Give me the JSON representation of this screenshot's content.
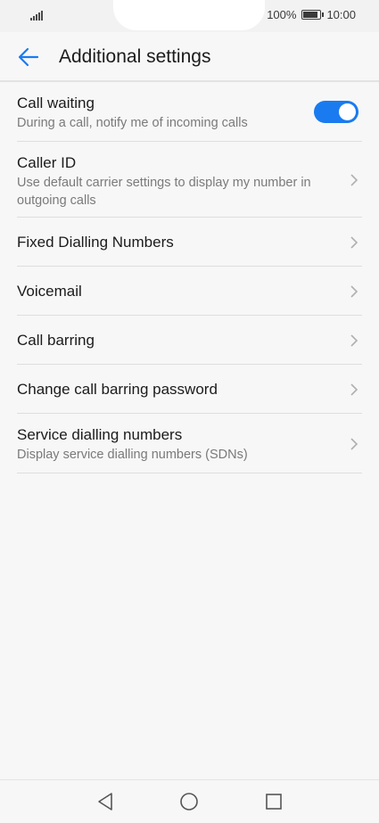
{
  "status_bar": {
    "battery_percent": "100%",
    "battery_level": 1.0,
    "time": "10:00"
  },
  "header": {
    "title": "Additional settings",
    "back_icon": "arrow-left-icon"
  },
  "settings": [
    {
      "label": "Call waiting",
      "sublabel": "During a call, notify me of incoming calls",
      "control": "toggle",
      "toggle_on": true
    },
    {
      "label": "Caller ID",
      "sublabel": "Use default carrier settings to display my number in outgoing calls",
      "control": "chevron"
    },
    {
      "label": "Fixed Dialling Numbers",
      "sublabel": "",
      "control": "chevron"
    },
    {
      "label": "Voicemail",
      "sublabel": "",
      "control": "chevron"
    },
    {
      "label": "Call barring",
      "sublabel": "",
      "control": "chevron"
    },
    {
      "label": "Change call barring password",
      "sublabel": "",
      "control": "chevron"
    },
    {
      "label": "Service dialling numbers",
      "sublabel": "Display service dialling numbers (SDNs)",
      "control": "chevron"
    }
  ],
  "colors": {
    "accent": "#1a7bf0",
    "background": "#f7f7f7",
    "secondary_text": "#7a7a7a"
  },
  "nav_bar": {
    "icons": [
      "back-triangle-icon",
      "home-circle-icon",
      "recents-square-icon"
    ]
  }
}
